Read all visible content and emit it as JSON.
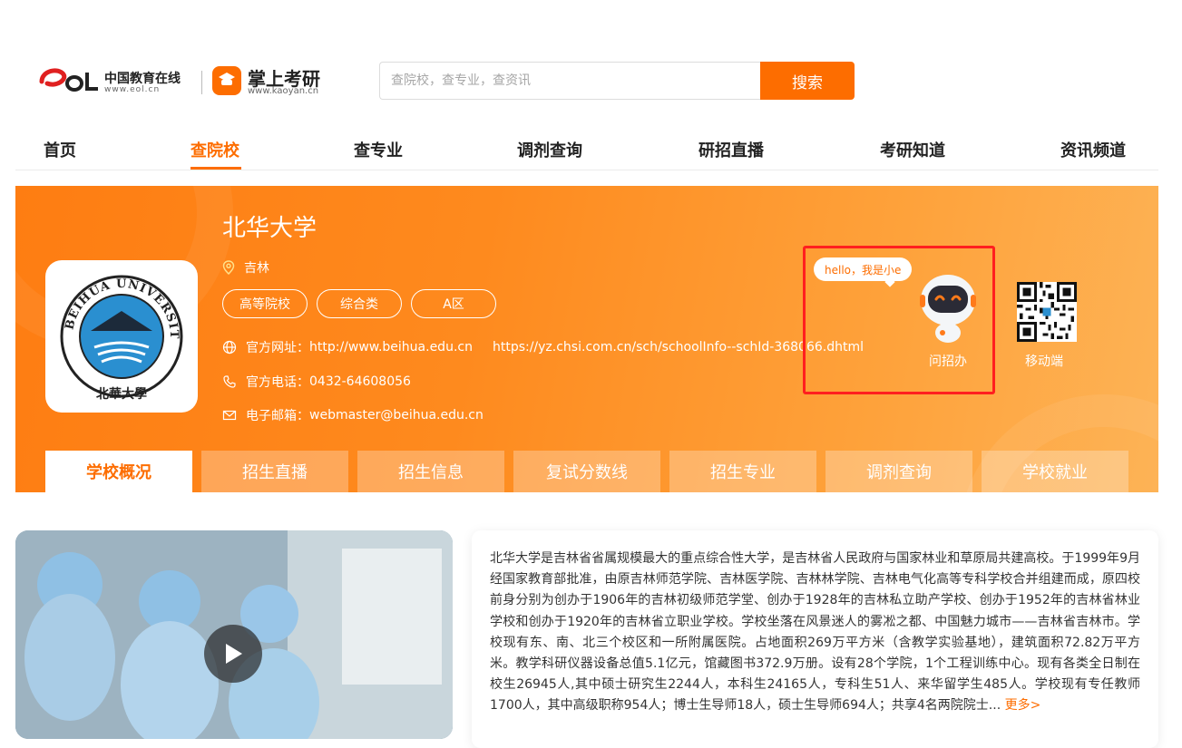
{
  "brand": {
    "eol_cn": "中国教育在线",
    "eol_url": "www.eol.cn",
    "ky_name": "掌上考研",
    "ky_url": "www.kaoyan.cn",
    "ky_badge": "考研"
  },
  "search": {
    "placeholder": "查院校，查专业，查资讯",
    "button_label": "搜索"
  },
  "nav": {
    "items": [
      {
        "label": "首页"
      },
      {
        "label": "查院校",
        "active": true
      },
      {
        "label": "查专业"
      },
      {
        "label": "调剂查询"
      },
      {
        "label": "研招直播"
      },
      {
        "label": "考研知道"
      },
      {
        "label": "资讯频道"
      }
    ]
  },
  "school": {
    "name": "北华大学",
    "location": "吉林",
    "tags": [
      "高等院校",
      "综合类",
      "A区"
    ],
    "website_label": "官方网址：",
    "website": "http://www.beihua.edu.cn",
    "chsi_link": "https://yz.chsi.com.cn/sch/schoolInfo--schId-368066.dhtml",
    "phone_label": "官方电话：",
    "phone": "0432-64608056",
    "email_label": "电子邮箱：",
    "email": "webmaster@beihua.edu.cn",
    "logo_text": "BEIHUA UNIVERSITY",
    "logo_cn": "北華大學"
  },
  "assistant": {
    "bubble": "hello，我是小e",
    "label": "问招办",
    "mobile_label": "移动端"
  },
  "tabs": [
    {
      "label": "学校概况",
      "active": true
    },
    {
      "label": "招生直播"
    },
    {
      "label": "招生信息"
    },
    {
      "label": "复试分数线"
    },
    {
      "label": "招生专业"
    },
    {
      "label": "调剂查询"
    },
    {
      "label": "学校就业"
    }
  ],
  "intro": {
    "text": "北华大学是吉林省省属规模最大的重点综合性大学，是吉林省人民政府与国家林业和草原局共建高校。于1999年9月经国家教育部批准，由原吉林师范学院、吉林医学院、吉林林学院、吉林电气化高等专科学校合并组建而成，原四校前身分别为创办于1906年的吉林初级师范学堂、创办于1928年的吉林私立助产学校、创办于1952年的吉林省林业学校和创办于1920年的吉林省立职业学校。学校坐落在风景迷人的雾凇之都、中国魅力城市——吉林省吉林市。学校现有东、南、北三个校区和一所附属医院。占地面积269万平方米（含教学实验基地），建筑面积72.82万平方米。教学科研仪器设备总值5.1亿元，馆藏图书372.9万册。设有28个学院，1个工程训练中心。现有各类全日制在校生26945人,其中硕士研究生2244人，本科生24165人，专科生51人、来华留学生485人。学校现有专任教师1700人，其中高级职称954人；博士生导师18人，硕士生导师694人；共享4名两院院士...",
    "more": "更多>"
  },
  "colors": {
    "accent": "#fd6d00",
    "highlight": "#ff1f1f"
  }
}
